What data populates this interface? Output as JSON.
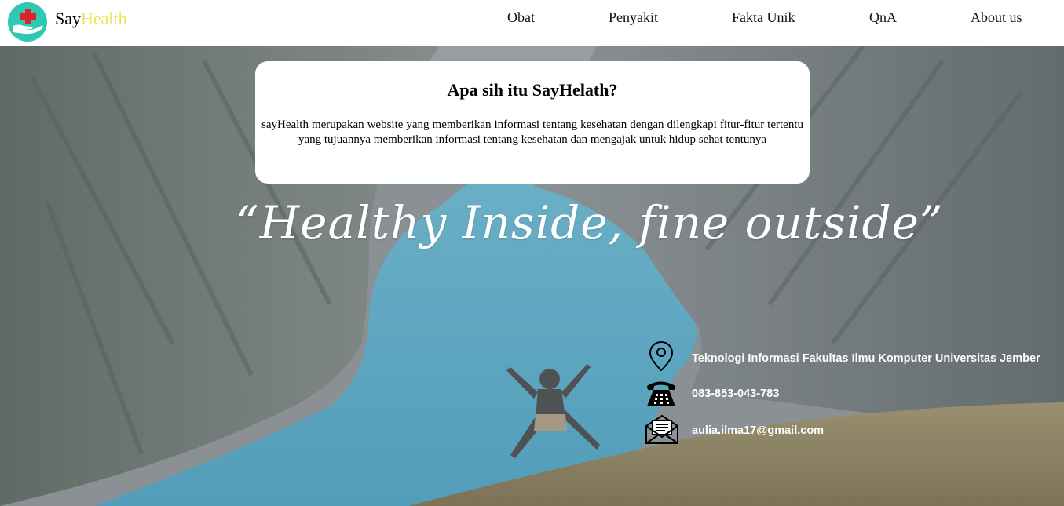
{
  "brand": {
    "name_part1": "Say",
    "name_part2": "Health",
    "accent_color": "#f0e35a"
  },
  "nav": {
    "items": [
      {
        "label": "Obat"
      },
      {
        "label": "Penyakit"
      },
      {
        "label": "Fakta Unik"
      },
      {
        "label": "QnA"
      },
      {
        "label": "About us"
      }
    ]
  },
  "info": {
    "title": "Apa sih itu SayHelath?",
    "text": "sayHealth merupakan website yang memberikan informasi tentang kesehatan dengan dilengkapi fitur-fitur tertentu yang tujuannya memberikan informasi tentang kesehatan dan mengajak untuk hidup sehat tentunya"
  },
  "hero": {
    "tagline": "“Healthy Inside, fine outside”"
  },
  "contact": {
    "address": "Teknologi Informasi Fakultas Ilmu Komputer Universitas Jember",
    "phone": "083-853-043-783",
    "email": "aulia.ilma17@gmail.com"
  },
  "icons": {
    "logo": "health-hand-logo-icon",
    "address": "map-pin-icon",
    "phone": "telephone-icon",
    "email": "envelope-icon"
  },
  "colors": {
    "logo_circle": "#2fc9b3",
    "logo_cross": "#e0202a",
    "navbar_bg": "#ffffff"
  }
}
